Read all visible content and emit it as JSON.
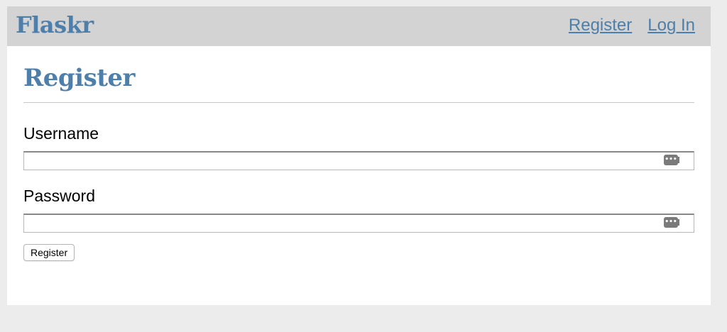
{
  "nav": {
    "brand": "Flaskr",
    "links": [
      {
        "label": "Register"
      },
      {
        "label": "Log In"
      }
    ]
  },
  "main": {
    "heading": "Register",
    "form": {
      "username": {
        "label": "Username",
        "value": "",
        "placeholder": ""
      },
      "password": {
        "label": "Password",
        "value": "",
        "placeholder": ""
      },
      "submit_label": "Register"
    }
  },
  "icons": {
    "password_manager": "key-icon"
  },
  "colors": {
    "accent": "#4d7faa",
    "nav_background": "#d3d3d3",
    "page_background": "#ececec",
    "content_background": "#ffffff"
  }
}
